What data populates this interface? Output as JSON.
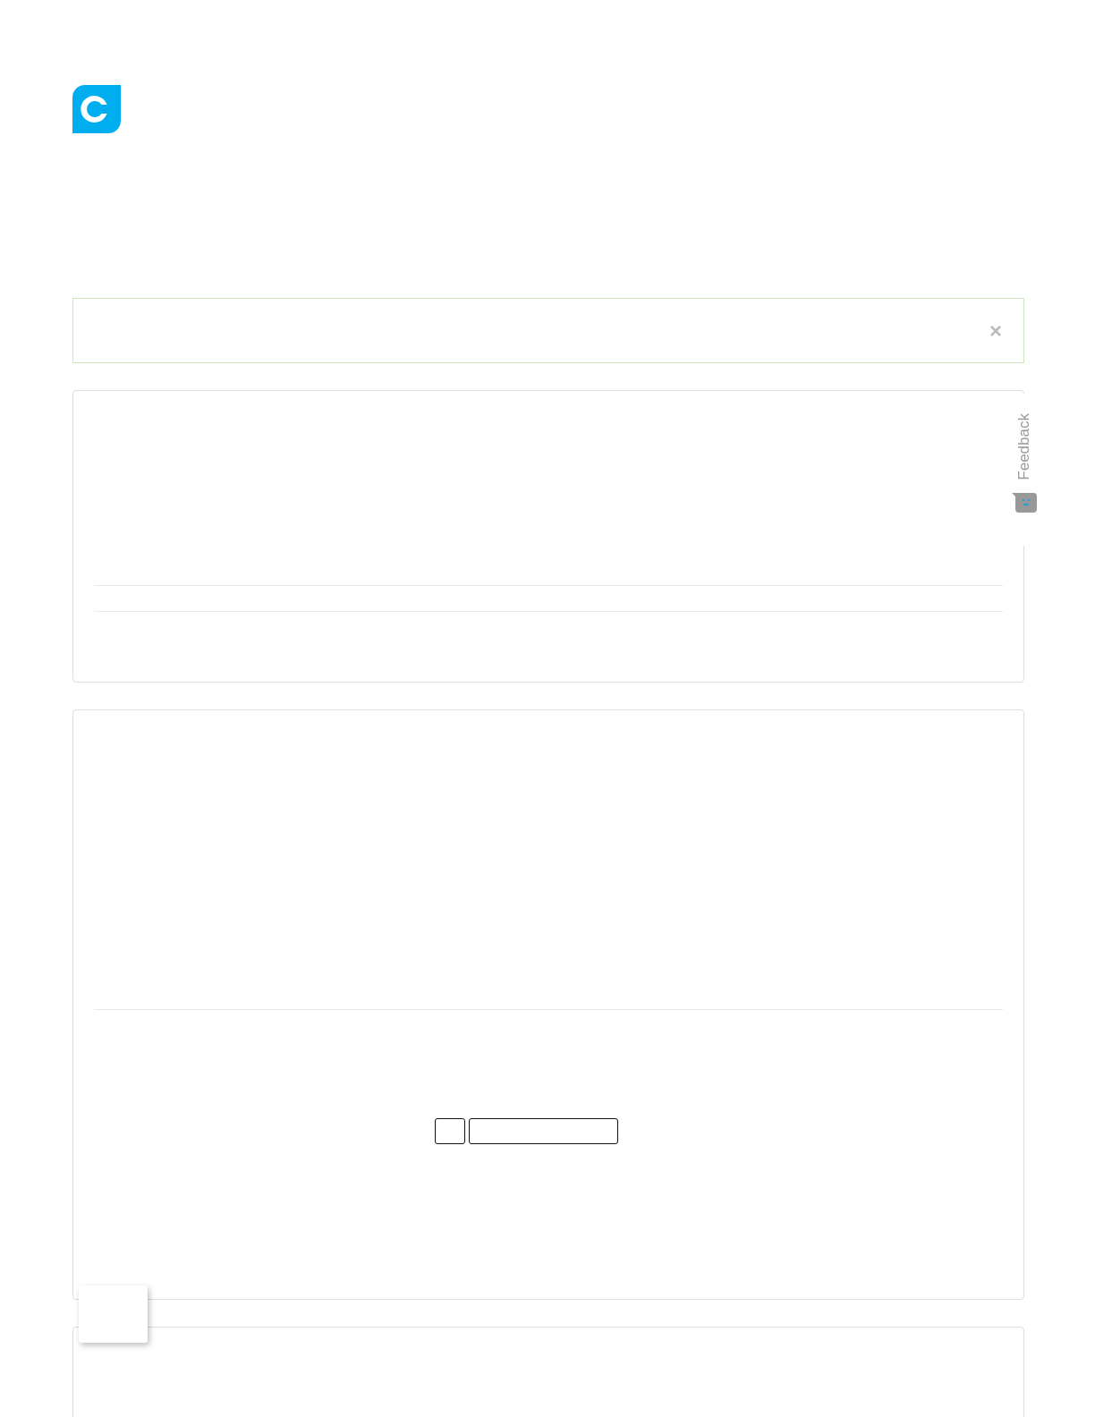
{
  "alert": {
    "close": "×"
  },
  "feedback_tab": {
    "label": "Feedback"
  }
}
